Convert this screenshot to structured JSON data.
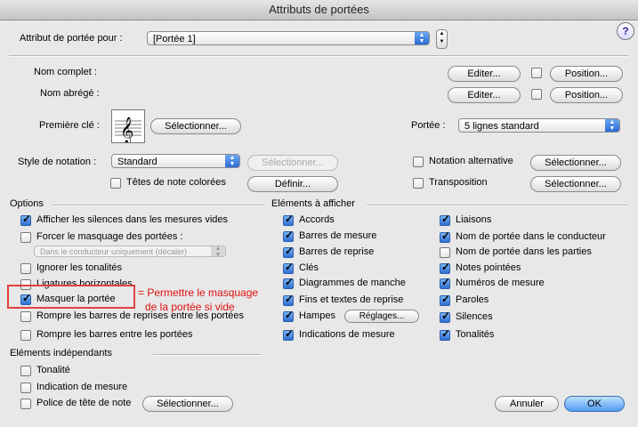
{
  "window": {
    "title": "Attributs de portées"
  },
  "header": {
    "label": "Attribut de portée pour :",
    "select_value": "[Portée 1]",
    "help_label": "?"
  },
  "names": {
    "full_label": "Nom complet :",
    "short_label": "Nom abrégé :",
    "edit_label": "Editer...",
    "position_label": "Position..."
  },
  "clef": {
    "label": "Première clé :",
    "select_label": "Sélectionner...",
    "glyph": "𝄞"
  },
  "staff": {
    "label": "Portée :",
    "value": "5 lignes standard"
  },
  "notation": {
    "label": "Style de notation :",
    "value": "Standard",
    "select_label": "Sélectionner...",
    "colored_heads": "Têtes de note colorées",
    "define_label": "Définir...",
    "alt_label": "Notation alternative",
    "alt_button": "Sélectionner...",
    "transpose_label": "Transposition",
    "transpose_button": "Sélectionner..."
  },
  "options": {
    "heading": "Options",
    "items": [
      {
        "label": "Afficher les silences dans les mesures vides",
        "checked": true
      },
      {
        "label": "Forcer le masquage des portées :",
        "checked": false
      },
      {
        "label": "Ignorer les tonalités",
        "checked": false
      },
      {
        "label": "Ligatures horizontales",
        "checked": false
      },
      {
        "label": "Masquer la portée",
        "checked": true
      },
      {
        "label": "Rompre les barres de reprises entre les portées",
        "checked": false
      },
      {
        "label": "Rompre les barres entre les portées",
        "checked": false
      }
    ],
    "force_select": "Dans le conducteur uniquement (décaler)"
  },
  "annotation": {
    "line1": "= Permettre le masquage",
    "line2": "de la portée si vide"
  },
  "elements": {
    "heading": "Eléments à afficher",
    "col1": [
      {
        "label": "Accords",
        "checked": true
      },
      {
        "label": "Barres de mesure",
        "checked": true
      },
      {
        "label": "Barres de reprise",
        "checked": true
      },
      {
        "label": "Clés",
        "checked": true
      },
      {
        "label": "Diagrammes de manche",
        "checked": true
      },
      {
        "label": "Fins et textes de reprise",
        "checked": true
      },
      {
        "label": "Hampes",
        "checked": true
      },
      {
        "label": "Indications de mesure",
        "checked": true
      }
    ],
    "settings_label": "Réglages...",
    "col2": [
      {
        "label": "Liaisons",
        "checked": true
      },
      {
        "label": "Nom de portée dans le conducteur",
        "checked": true
      },
      {
        "label": "Nom de portée dans les parties",
        "checked": false
      },
      {
        "label": "Notes pointées",
        "checked": true
      },
      {
        "label": "Numéros de mesure",
        "checked": true
      },
      {
        "label": "Paroles",
        "checked": true
      },
      {
        "label": "Silences",
        "checked": true
      },
      {
        "label": "Tonalités",
        "checked": true
      }
    ]
  },
  "independent": {
    "heading": "Eléments indépendants",
    "items": [
      {
        "label": "Tonalité",
        "checked": false
      },
      {
        "label": "Indication de mesure",
        "checked": false
      },
      {
        "label": "Police de tête de note",
        "checked": false
      }
    ],
    "select_label": "Sélectionner..."
  },
  "footer": {
    "cancel_label": "Annuler",
    "ok_label": "OK"
  }
}
